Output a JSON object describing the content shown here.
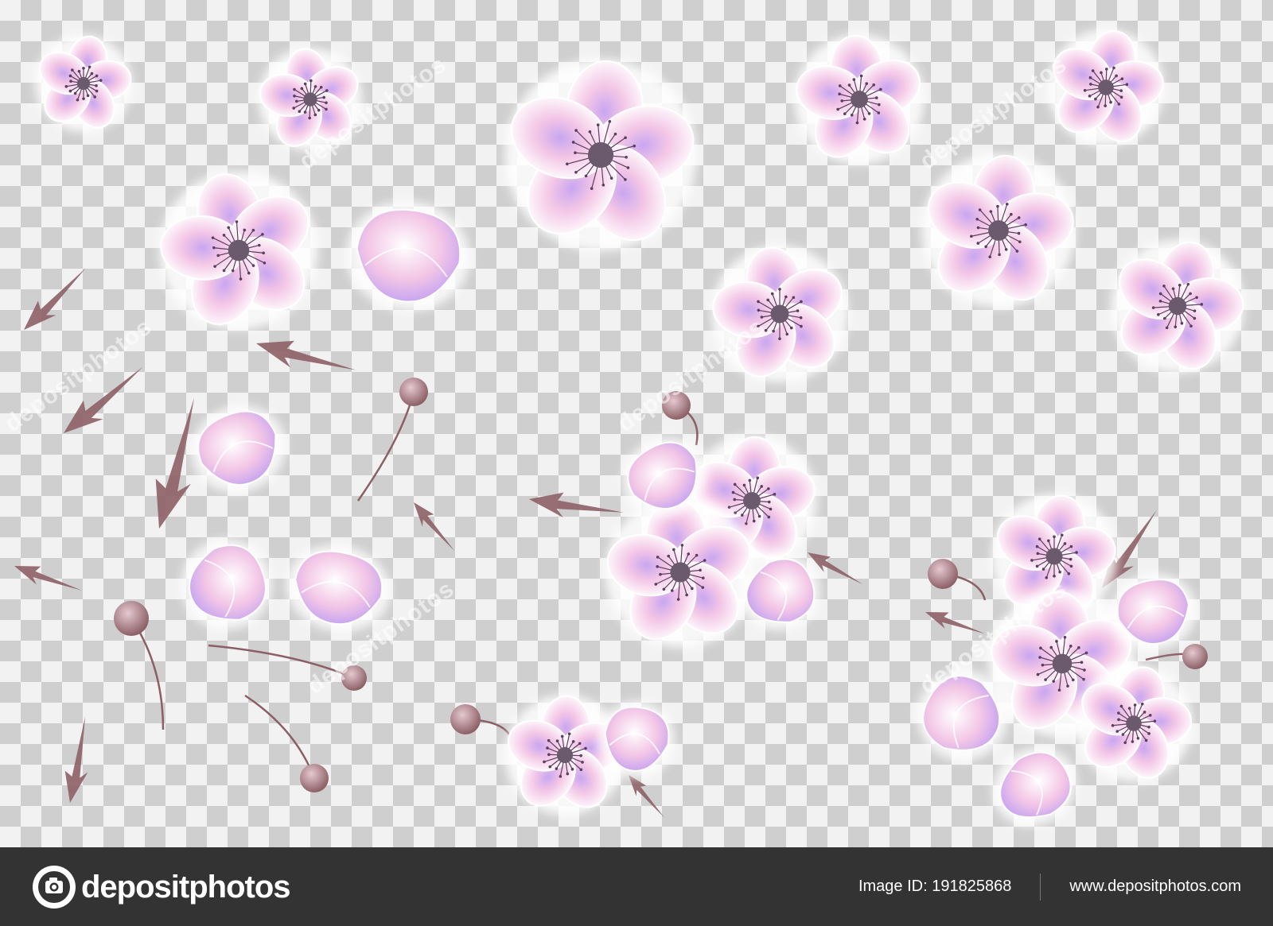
{
  "image": {
    "subject": "pink-white anemone blossoms on transparency checkerboard",
    "colors": {
      "petal_white": "#ffffff",
      "petal_pink": "#f3c6e6",
      "petal_violet": "#c9a6f0",
      "center": "#6b5a6e",
      "stamen": "#5a3f5e",
      "leaf": "#8c5f66",
      "checker_light": "#f2f2f2",
      "checker_dark": "#cfcfcf"
    }
  },
  "watermark": {
    "text": "depositphotos"
  },
  "footer": {
    "brand": "depositphotos",
    "image_id": "Image ID: 191825868",
    "site": "www.depositphotos.com",
    "background": "#333333"
  }
}
